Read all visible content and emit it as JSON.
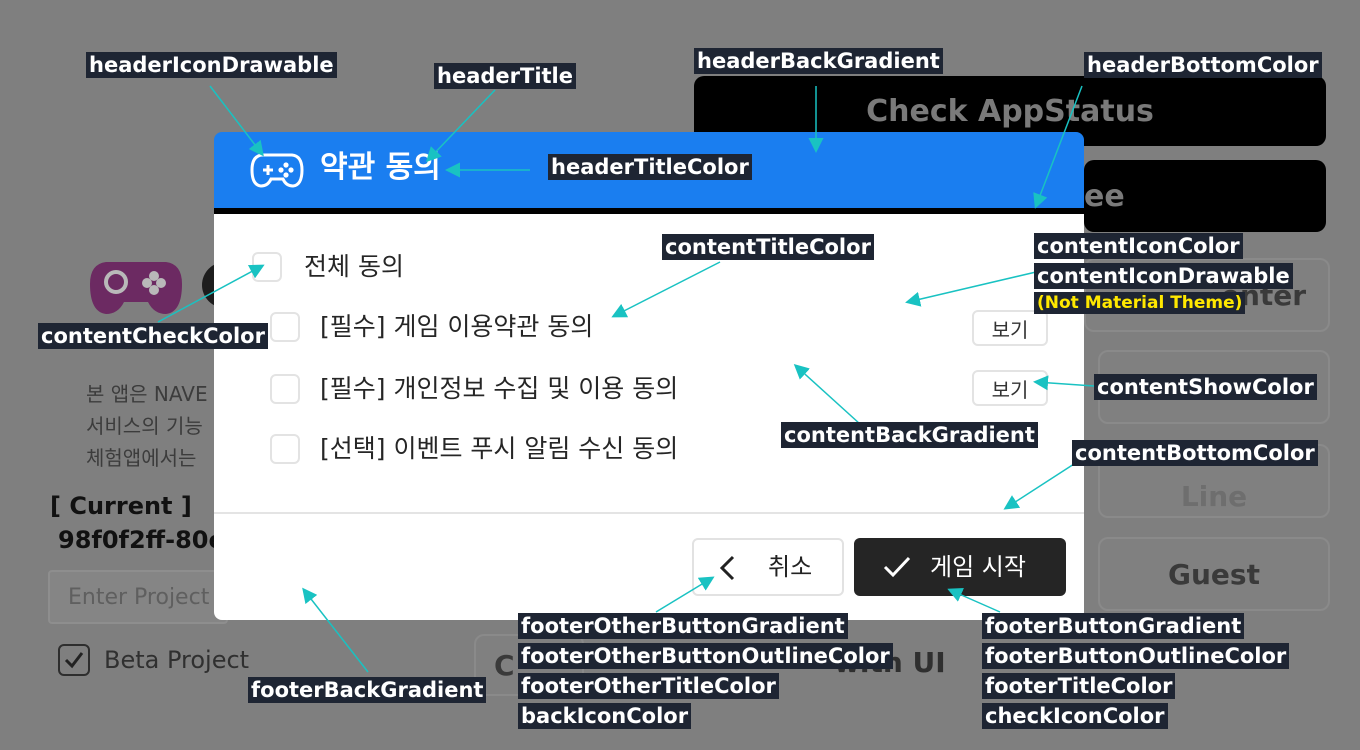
{
  "background": {
    "buttons": {
      "check_app_status": "Check AppStatus",
      "terms_partial": "ee",
      "center_partial": "enter",
      "line_partial": "Line",
      "guest": "Guest",
      "with_ui_partial": "with UI",
      "c_partial": "C"
    },
    "description_lines": [
      "본 앱은 NAVE",
      "서비스의 기능",
      "체험앱에서는"
    ],
    "current_label": "[ Current ]",
    "current_value": "98f0f2ff-80e",
    "project_input_placeholder": "Enter Project",
    "beta_project_label": "Beta Project",
    "beta_project_checked": true
  },
  "dialog": {
    "header": {
      "title": "약관 동의",
      "icon": "gamepad-icon",
      "background_color": "#1a7ef0",
      "bottom_color": "#000000"
    },
    "content": {
      "agree_all": {
        "label": "전체 동의",
        "checked": false
      },
      "items": [
        {
          "label": "[필수] 게임 이용약관 동의",
          "checked": false,
          "show_label": "보기"
        },
        {
          "label": "[필수] 개인정보 수집 및 이용 동의",
          "checked": false,
          "show_label": "보기"
        },
        {
          "label": "[선택] 이벤트 푸시 알림 수신 동의",
          "checked": false
        }
      ]
    },
    "footer": {
      "cancel_label": "취소",
      "cancel_icon": "chevron-left-icon",
      "start_label": "게임 시작",
      "start_icon": "check-icon",
      "start_button_color": "#252525"
    }
  },
  "annotations": {
    "header_icon_drawable": "headerIconDrawable",
    "header_title": "headerTitle",
    "header_back_gradient": "headerBackGradient",
    "header_bottom_color": "headerBottomColor",
    "header_title_color": "headerTitleColor",
    "content_title_color": "contentTitleColor",
    "content_icon_color": "contentIconColor",
    "content_icon_drawable": "contentIconDrawable",
    "content_icon_note": "(Not Material Theme)",
    "content_check_color": "contentCheckColor",
    "content_show_color": "contentShowColor",
    "content_back_gradient": "contentBackGradient",
    "content_bottom_color": "contentBottomColor",
    "footer_back_gradient": "footerBackGradient",
    "footer_other_button_gradient": "footerOtherButtonGradient",
    "footer_other_button_outline_color": "footerOtherButtonOutlineColor",
    "footer_other_title_color": "footerOtherTitleColor",
    "back_icon_color": "backIconColor",
    "footer_button_gradient": "footerButtonGradient",
    "footer_button_outline_color": "footerButtonOutlineColor",
    "footer_title_color": "footerTitleColor",
    "check_icon_color": "checkIconColor",
    "arrow_color": "#19c2c2"
  }
}
